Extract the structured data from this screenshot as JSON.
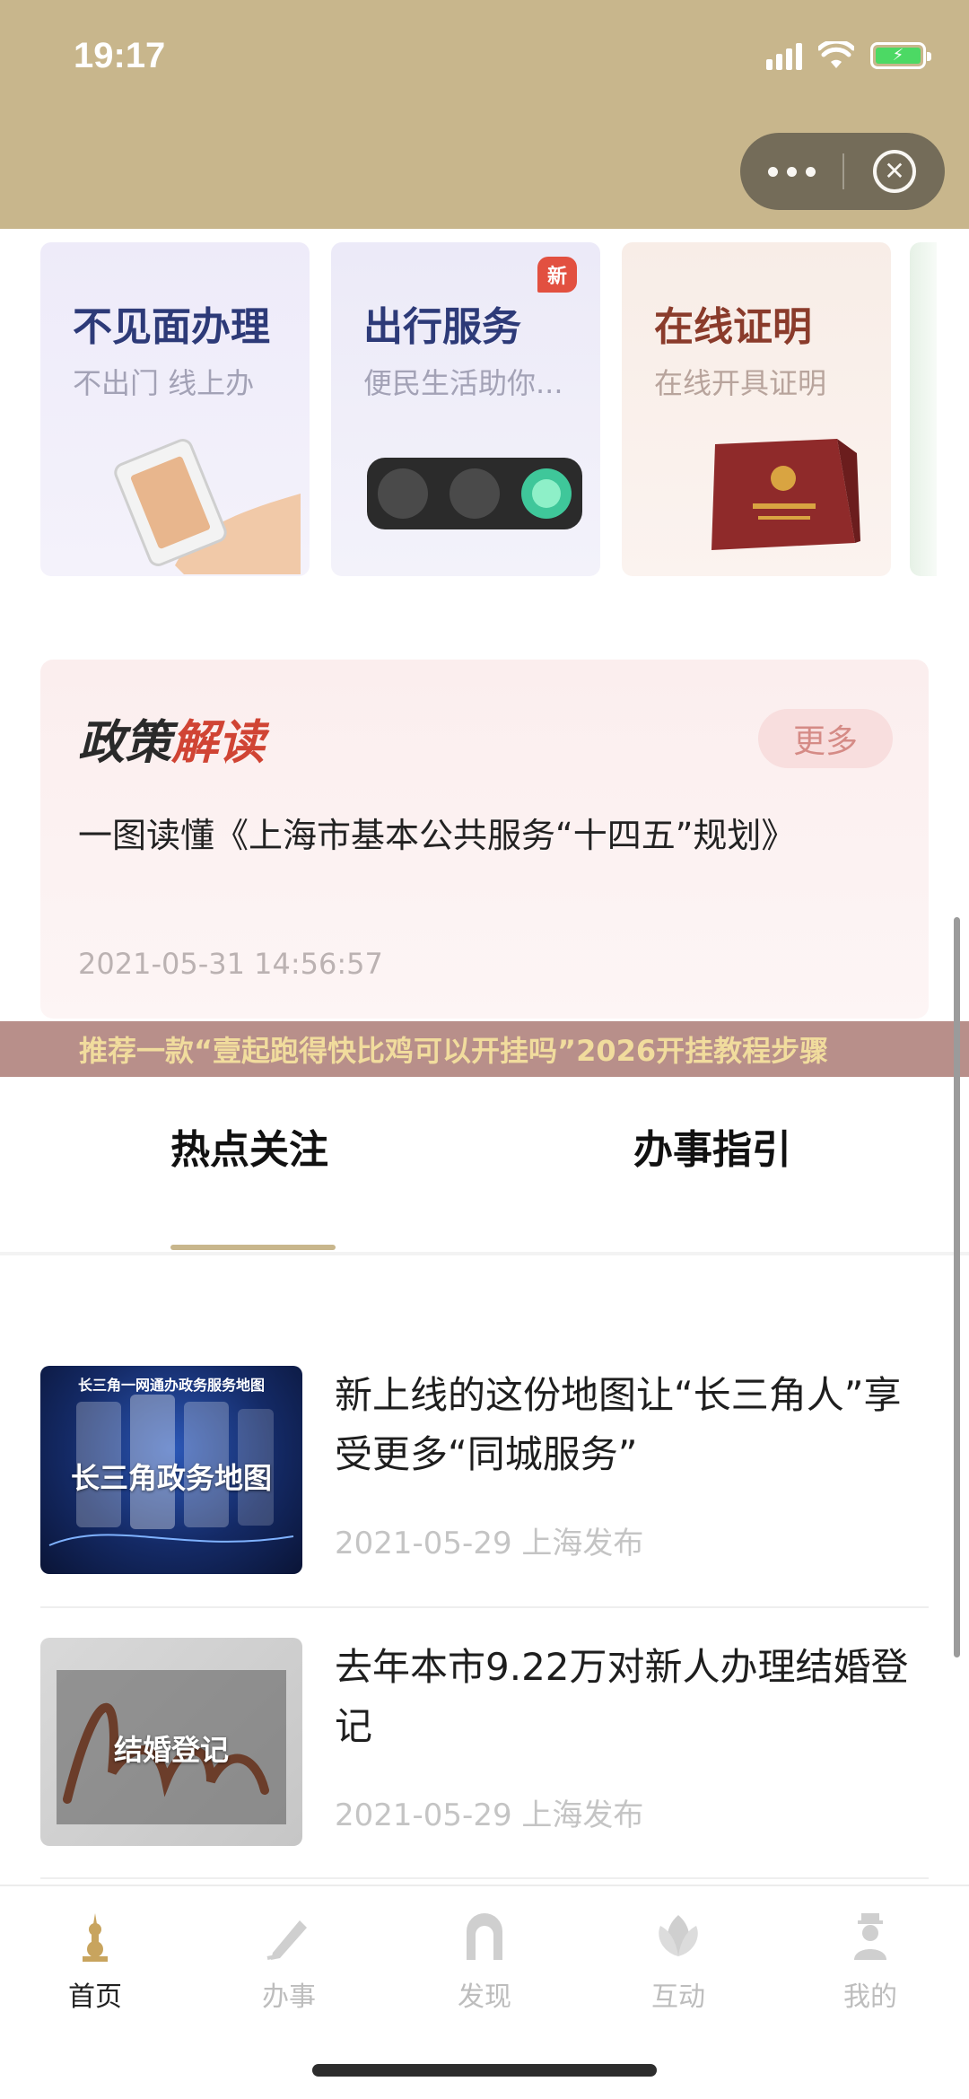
{
  "status_bar": {
    "time": "19:17"
  },
  "capsule": {
    "more_icon": "more-dots-icon",
    "close_icon": "close-circle-icon",
    "close_glyph": "✕"
  },
  "service_cards": [
    {
      "title": "不见面办理",
      "subtitle": "不出门 线上办"
    },
    {
      "title": "出行服务",
      "subtitle": "便民生活助你...",
      "badge": "新"
    },
    {
      "title": "在线证明",
      "subtitle": "在线开具证明"
    }
  ],
  "policy": {
    "title_part1": "政策",
    "title_part2": "解读",
    "more_label": "更多",
    "headline": "一图读懂《上海市基本公共服务“十四五”规划》",
    "timestamp": "2021-05-31 14:56:57"
  },
  "overlay_banner": {
    "text": "推荐一款“壹起跑得快比鸡可以开挂吗”2026开挂教程步骤"
  },
  "tabs": [
    {
      "label": "热点关注",
      "active": true
    },
    {
      "label": "办事指引",
      "active": false
    }
  ],
  "news": [
    {
      "thumb_top": "长三角一网通办政务服务地图",
      "thumb_label": "长三角政务地图",
      "headline": "新上线的这份地图让“长三角人”享受更多“同城服务”",
      "meta": "2021-05-29 上海发布"
    },
    {
      "thumb_label": "结婚登记",
      "headline": "去年本市9.22万对新人办理结婚登记",
      "meta": "2021-05-29 上海发布"
    }
  ],
  "bottom_nav": [
    {
      "label": "首页",
      "icon": "home-tower-icon",
      "active": true
    },
    {
      "label": "办事",
      "icon": "pen-icon",
      "active": false
    },
    {
      "label": "发现",
      "icon": "arch-icon",
      "active": false
    },
    {
      "label": "互动",
      "icon": "magnolia-icon",
      "active": false
    },
    {
      "label": "我的",
      "icon": "person-icon",
      "active": false
    }
  ],
  "colors": {
    "header_bg": "#c8b68c",
    "accent_red": "#d04434",
    "tab_underline": "#c8b68c",
    "banner_bg": "#b88f8a",
    "banner_text": "#f1dc9d"
  }
}
